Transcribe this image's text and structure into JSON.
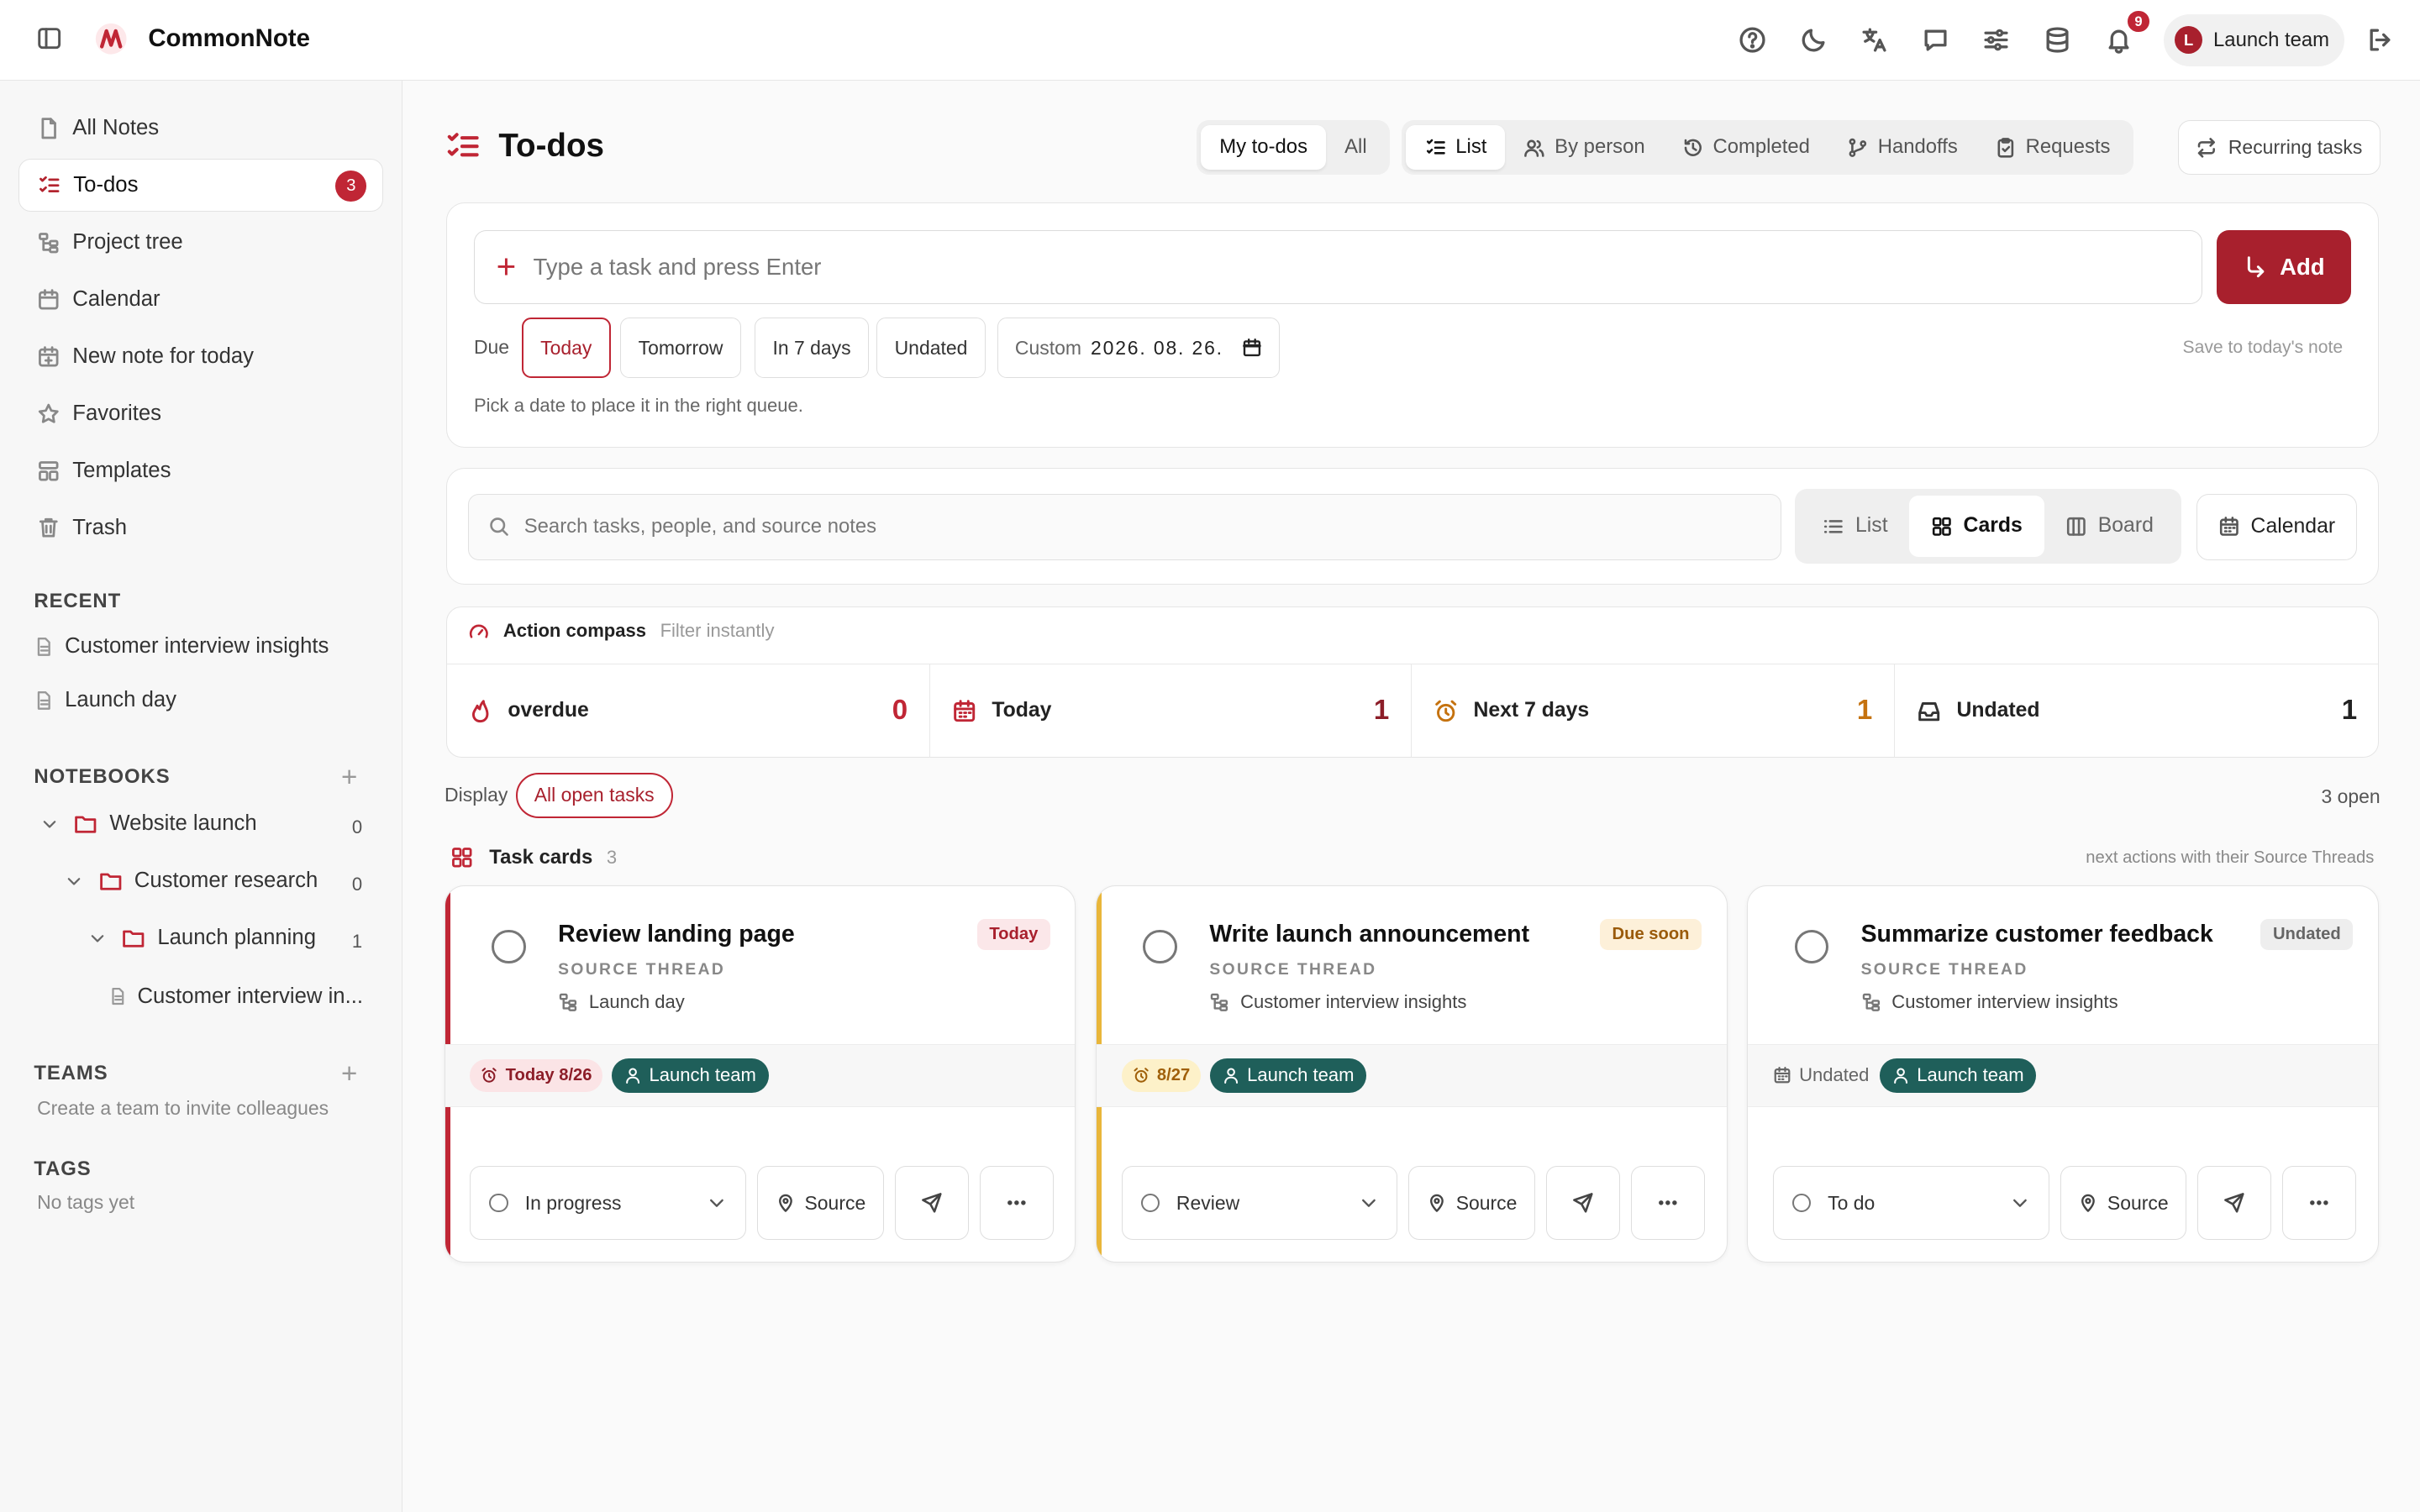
{
  "app": {
    "name": "CommonNote"
  },
  "topbar": {
    "notification_count": "9",
    "team": {
      "initial": "L",
      "name": "Launch team"
    }
  },
  "sidebar": {
    "nav": [
      {
        "label": "All Notes",
        "icon": "file-icon"
      },
      {
        "label": "To-dos",
        "icon": "checklist-icon",
        "badge": "3",
        "active": true
      },
      {
        "label": "Project tree",
        "icon": "tree-icon"
      },
      {
        "label": "Calendar",
        "icon": "calendar-icon"
      },
      {
        "label": "New note for today",
        "icon": "calendar-plus-icon"
      },
      {
        "label": "Favorites",
        "icon": "star-icon"
      },
      {
        "label": "Templates",
        "icon": "template-icon"
      },
      {
        "label": "Trash",
        "icon": "trash-icon"
      }
    ],
    "recent_heading": "RECENT",
    "recent": [
      "Customer interview insights",
      "Launch day"
    ],
    "notebooks_heading": "NOTEBOOKS",
    "notebooks": [
      {
        "label": "Website launch",
        "count": "0"
      },
      {
        "label": "Customer research",
        "count": "0"
      },
      {
        "label": "Launch planning",
        "count": "1"
      },
      {
        "label": "Customer interview in..."
      }
    ],
    "teams_heading": "TEAMS",
    "teams_empty": "Create a team to invite colleagues",
    "tags_heading": "TAGS",
    "tags_empty": "No tags yet"
  },
  "header": {
    "title": "To-dos",
    "scope": [
      "My to-dos",
      "All"
    ],
    "views": [
      "List",
      "By person",
      "Completed",
      "Handoffs",
      "Requests"
    ],
    "recurring": "Recurring tasks"
  },
  "composer": {
    "placeholder": "Type a task and press Enter",
    "add_label": "Add",
    "due_label": "Due",
    "due_options": [
      "Today",
      "Tomorrow",
      "In 7 days",
      "Undated"
    ],
    "custom_label": "Custom",
    "custom_date": "2026. 08. 26.",
    "save_note": "Save to today's note",
    "hint": "Pick a date to place it in the right queue."
  },
  "filters": {
    "search_placeholder": "Search tasks, people, and source notes",
    "layouts": [
      "List",
      "Cards",
      "Board"
    ],
    "selected_layout": "Cards",
    "calendar_label": "Calendar"
  },
  "compass": {
    "title": "Action compass",
    "subtitle": "Filter instantly",
    "stats": [
      {
        "label": "overdue",
        "value": "0",
        "color": "#c02635"
      },
      {
        "label": "Today",
        "value": "1",
        "color": "#8c1d28"
      },
      {
        "label": "Next 7 days",
        "value": "1",
        "color": "#c5720f"
      },
      {
        "label": "Undated",
        "value": "1",
        "color": "#222222"
      }
    ]
  },
  "display": {
    "label": "Display",
    "chip": "All open tasks",
    "open_count": "3 open"
  },
  "task_cards": {
    "heading": "Task cards",
    "count": "3",
    "note": "next actions with their Source Threads",
    "source_thread_label": "SOURCE THREAD",
    "items": [
      {
        "title": "Review landing page",
        "tag": "Today",
        "source": "Launch day",
        "due": "Today 8/26",
        "team": "Launch team",
        "status": "In progress",
        "source_btn": "Source"
      },
      {
        "title": "Write launch announcement",
        "tag": "Due soon",
        "source": "Customer interview insights",
        "due": "8/27",
        "team": "Launch team",
        "status": "Review",
        "source_btn": "Source"
      },
      {
        "title": "Summarize customer feedback",
        "tag": "Undated",
        "source": "Customer interview insights",
        "due": "Undated",
        "team": "Launch team",
        "status": "To do",
        "source_btn": "Source"
      }
    ]
  },
  "colors": {
    "accent": "#a8202d",
    "team_tag": "#1f5f5a",
    "due_soon": "#c5720f"
  }
}
